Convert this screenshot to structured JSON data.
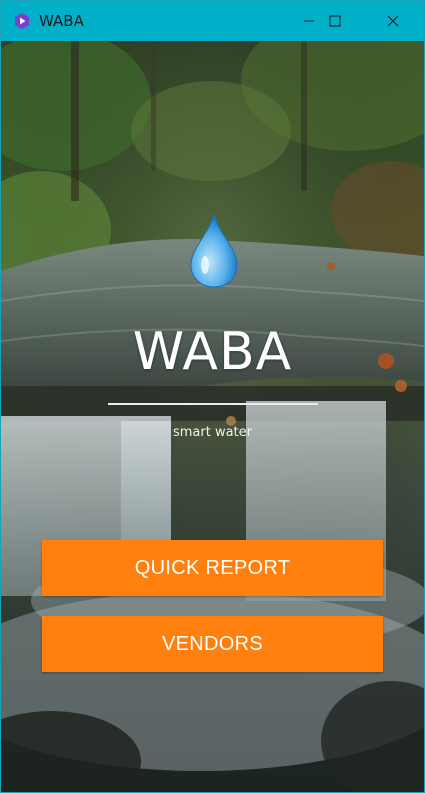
{
  "window": {
    "title": "WABA",
    "controls": [
      "minimize-icon",
      "maximize-icon",
      "close-icon"
    ],
    "titlebar_color": "#00b0c8"
  },
  "hero": {
    "app_name": "WABA",
    "tagline": "smart water",
    "icon": "water-drop-icon"
  },
  "buttons": {
    "quick_report": "QUICK REPORT",
    "vendors": "VENDORS",
    "color": "#ff7f0f"
  },
  "background": {
    "description_icon": "waterfall-forest-photo"
  }
}
